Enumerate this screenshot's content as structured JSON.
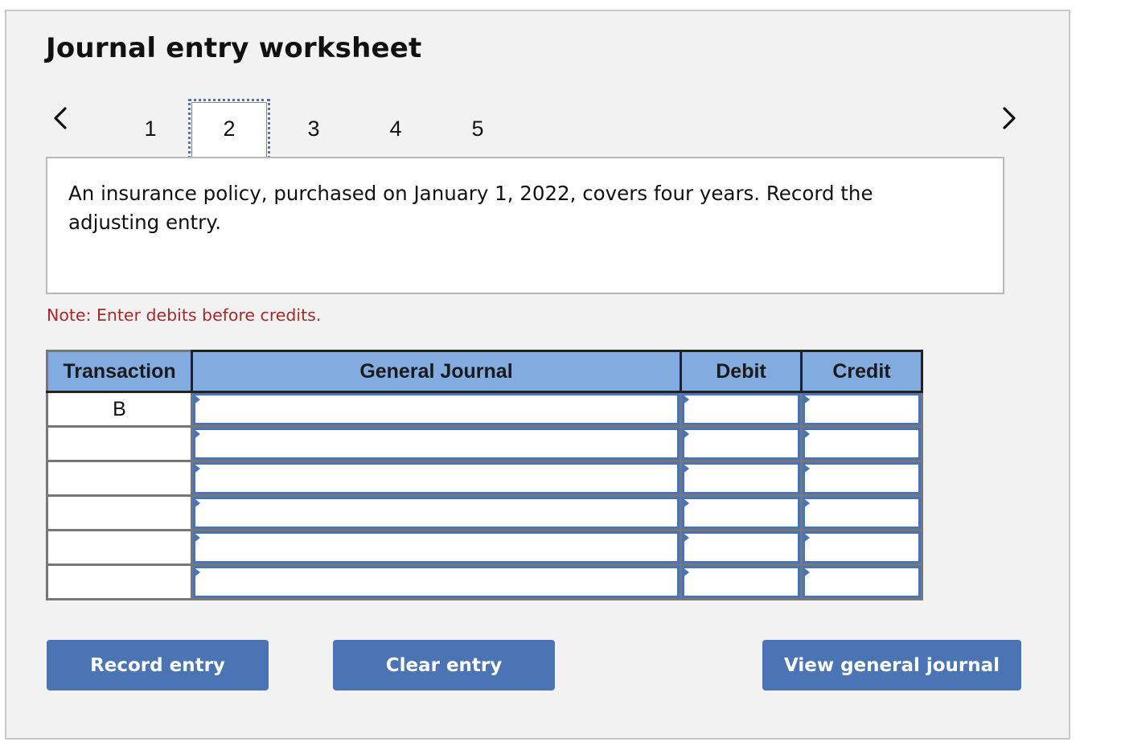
{
  "worksheet": {
    "title": "Journal entry worksheet",
    "nav": {
      "prev_icon": "chevron-left-icon",
      "next_icon": "chevron-right-icon",
      "tabs": [
        {
          "label": "1",
          "active": false
        },
        {
          "label": "2",
          "active": true
        },
        {
          "label": "3",
          "active": false
        },
        {
          "label": "4",
          "active": false
        },
        {
          "label": "5",
          "active": false
        }
      ]
    },
    "description": "An insurance policy, purchased on January 1, 2022, covers four years. Record the adjusting entry.",
    "note": "Note: Enter debits before credits.",
    "table": {
      "headers": {
        "transaction": "Transaction",
        "general_journal": "General Journal",
        "debit": "Debit",
        "credit": "Credit"
      },
      "rows": [
        {
          "transaction": "B",
          "account": "",
          "debit": "",
          "credit": ""
        },
        {
          "transaction": "",
          "account": "",
          "debit": "",
          "credit": ""
        },
        {
          "transaction": "",
          "account": "",
          "debit": "",
          "credit": ""
        },
        {
          "transaction": "",
          "account": "",
          "debit": "",
          "credit": ""
        },
        {
          "transaction": "",
          "account": "",
          "debit": "",
          "credit": ""
        },
        {
          "transaction": "",
          "account": "",
          "debit": "",
          "credit": ""
        }
      ]
    },
    "buttons": {
      "record": "Record entry",
      "clear": "Clear entry",
      "view": "View general journal"
    },
    "colors": {
      "accent": "#4a74b3",
      "header_bg": "#82abe0",
      "note": "#a52a2a",
      "panel_bg": "#f2f2f2"
    }
  }
}
